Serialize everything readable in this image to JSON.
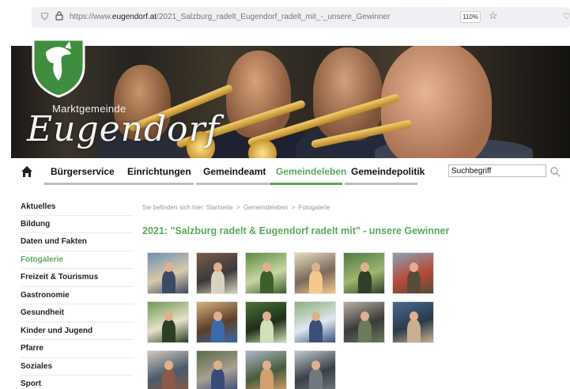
{
  "browser": {
    "url_prefix": "https://www.",
    "url_domain": "eugendorf.at",
    "url_path": "/2021_Salzburg_radelt_Eugendorf_radelt_mit_-_unsere_Gewinner",
    "zoom": "110%"
  },
  "banner": {
    "town_small": "Marktgemeinde",
    "town_big": "Eugendorf",
    "slide_count": 10,
    "active_slide": 0
  },
  "nav": {
    "items": [
      {
        "label": "Bürgerservice",
        "active": false
      },
      {
        "label": "Einrichtungen",
        "active": false
      },
      {
        "label": "Gemeindeamt",
        "active": false
      },
      {
        "label": "Gemeindeleben",
        "active": true
      },
      {
        "label": "Gemeindepolitik",
        "active": false
      }
    ],
    "search_value": "Suchbegriff"
  },
  "sidebar": {
    "items": [
      {
        "label": "Aktuelles",
        "active": false
      },
      {
        "label": "Bildung",
        "active": false
      },
      {
        "label": "Daten und Fakten",
        "active": false
      },
      {
        "label": "Fotogalerie",
        "active": true
      },
      {
        "label": "Freizeit & Tourismus",
        "active": false
      },
      {
        "label": "Gastronomie",
        "active": false
      },
      {
        "label": "Gesundheit",
        "active": false
      },
      {
        "label": "Kinder und Jugend",
        "active": false
      },
      {
        "label": "Pfarre",
        "active": false
      },
      {
        "label": "Soziales",
        "active": false
      },
      {
        "label": "Sport",
        "active": false
      }
    ]
  },
  "main": {
    "breadcrumb": {
      "prefix": "Sie befinden sich hier:",
      "items": [
        "Startseite",
        "Gemeindeleben",
        "Fotogalerie"
      ],
      "separator": ">"
    },
    "title": "2021: \"Salzburg radelt & Eugendorf radelt mit\" - unsere Gewinner",
    "photo_count": 16
  },
  "colors": {
    "accent": "#58a85a",
    "nav_bar": "#bdbdbd",
    "text": "#222222"
  }
}
